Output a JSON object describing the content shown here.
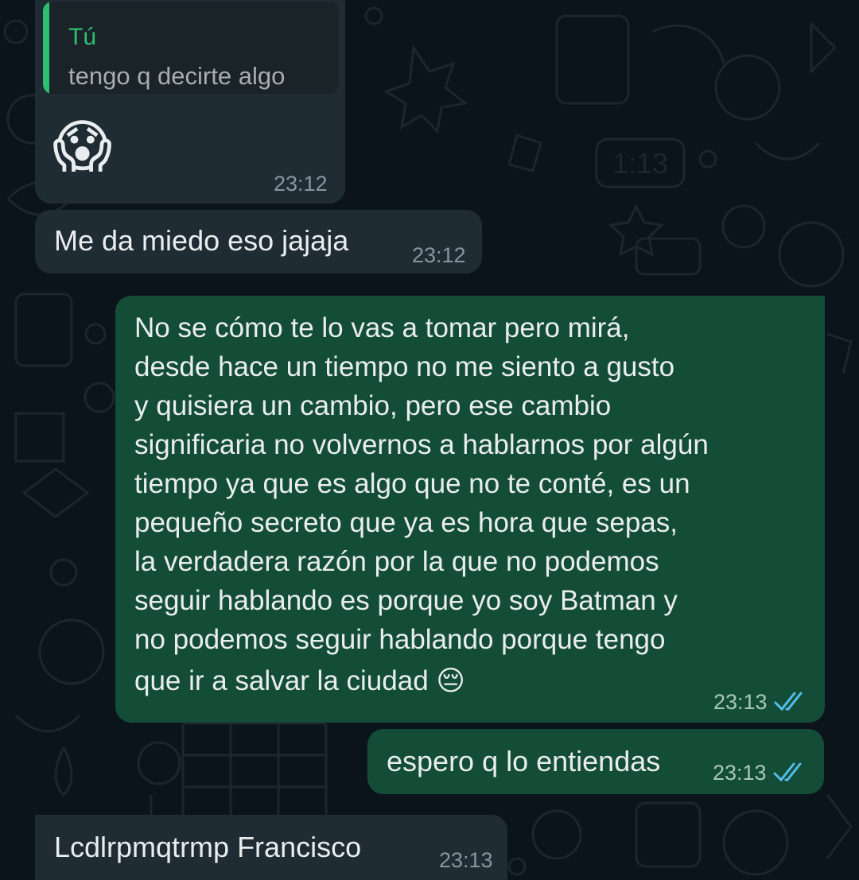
{
  "colors": {
    "background": "#0b141a",
    "incoming_bubble": "#202c33",
    "outgoing_bubble": "#144d37",
    "read_ticks": "#53bdeb",
    "quote_accent": "#2fbf71"
  },
  "messages": [
    {
      "direction": "incoming",
      "quoted": {
        "author": "Tú",
        "text": "tengo q decirte algo"
      },
      "emoji": "😱",
      "time": "23:12"
    },
    {
      "direction": "incoming",
      "text": "Me da miedo eso jajaja",
      "time": "23:12"
    },
    {
      "direction": "outgoing",
      "lines": [
        "No se cómo te lo vas a tomar pero mirá,",
        "desde hace un tiempo no me siento a gusto",
        "y quisiera un cambio, pero ese cambio",
        "significaria no volvernos a hablarnos por algún",
        "tiempo ya que es algo que no te conté, es un",
        "pequeño secreto que ya es hora que sepas,",
        "la verdadera razón por la que no podemos",
        "seguir hablando es porque yo soy Batman y",
        "no podemos seguir hablando porque tengo",
        "que ir a salvar la ciudad 😔"
      ],
      "time": "23:13",
      "status_icon": "double-check-read-icon"
    },
    {
      "direction": "outgoing",
      "text": "espero q lo entiendas",
      "time": "23:13",
      "status_icon": "double-check-read-icon"
    },
    {
      "direction": "incoming",
      "text": "Lcdlrpmqtrmp Francisco",
      "time": "23:13"
    }
  ]
}
